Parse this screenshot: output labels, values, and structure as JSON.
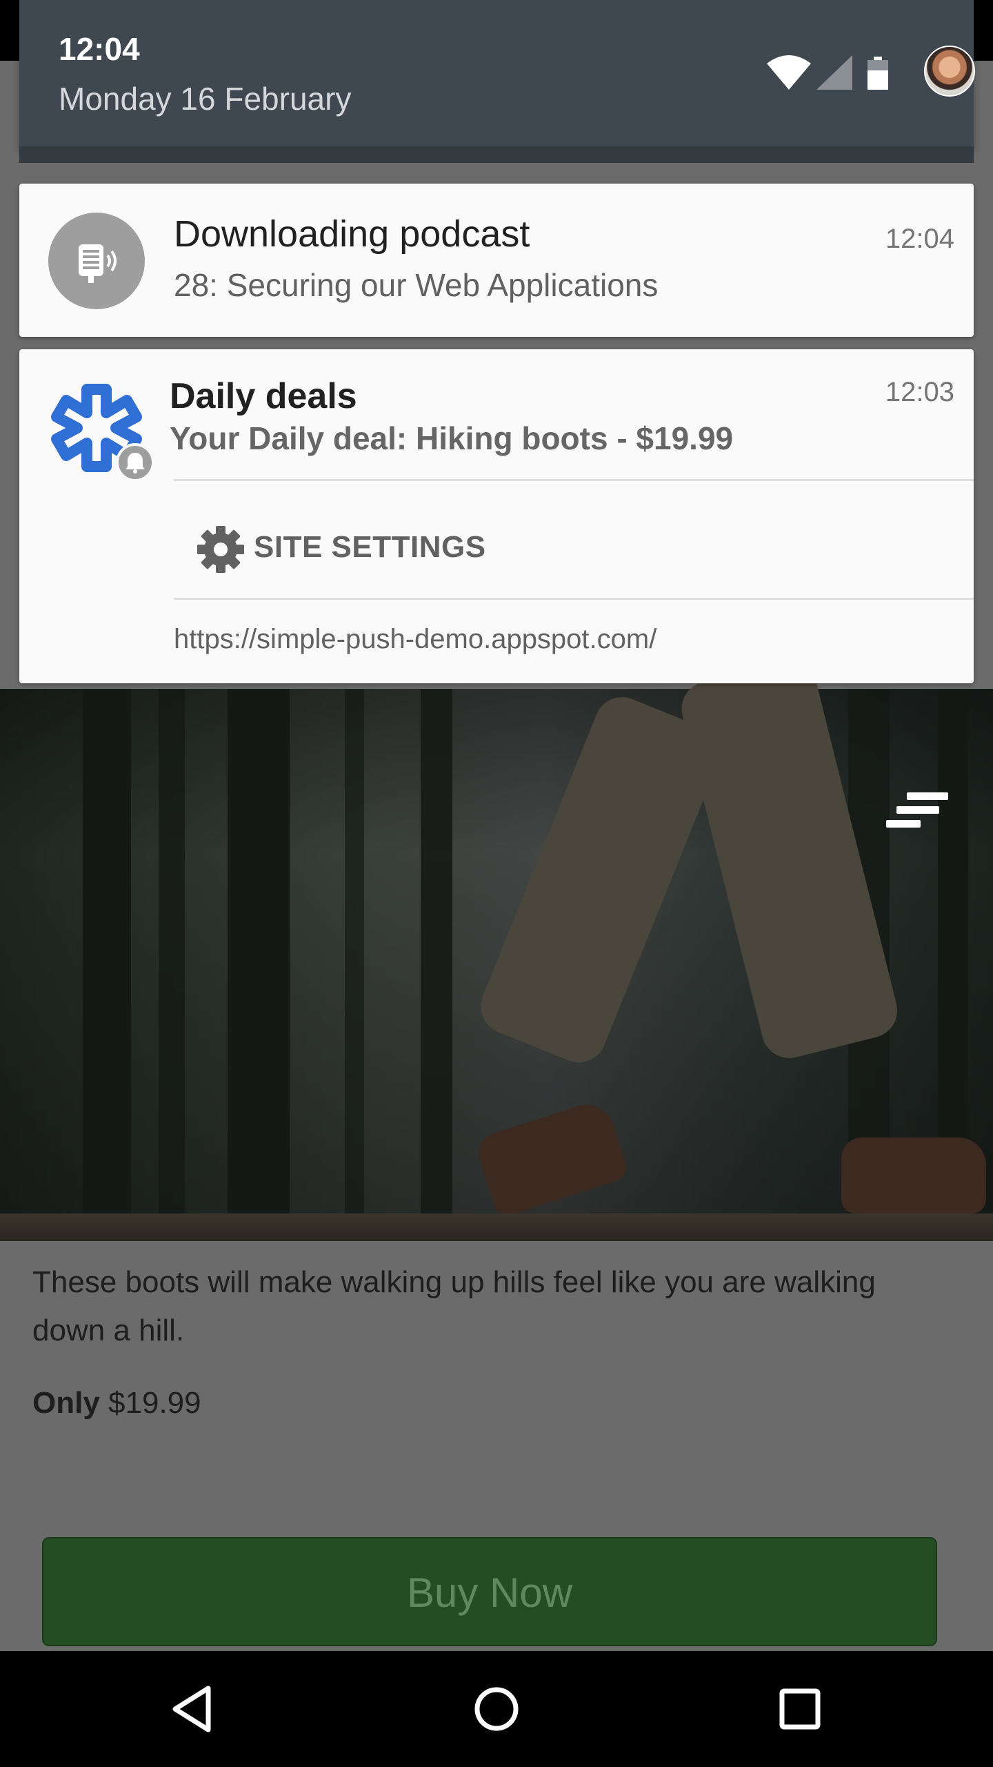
{
  "status": {
    "time": "12:04",
    "date": "Monday 16 February"
  },
  "notifications": [
    {
      "title": "Downloading podcast",
      "text": "28: Securing our Web Applications",
      "time": "12:04",
      "icon": "podcast-icon"
    },
    {
      "title": "Daily deals",
      "text": "Your Daily deal: Hiking boots - $19.99",
      "time": "12:03",
      "icon": "daily-deals-logo",
      "action_label": "SITE SETTINGS",
      "action_icon": "gear-icon",
      "origin": "https://simple-push-demo.appspot.com/"
    }
  ],
  "page": {
    "description": "These boots will make walking up hills feel like you are walking down a hill.",
    "price_prefix": "Only",
    "price": "$19.99",
    "buy_label": "Buy Now",
    "menu_icon": "menu-icon"
  },
  "navbar": {
    "back": "back-icon",
    "home": "home-icon",
    "recents": "recents-icon"
  },
  "colors": {
    "shade_header": "#3f4850",
    "card_bg": "#fafafa",
    "deals_blue": "#2f6fd6",
    "buy_button": "#244d24"
  }
}
